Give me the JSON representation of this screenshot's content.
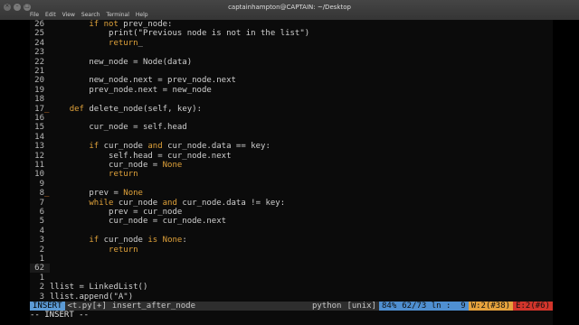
{
  "window": {
    "title": "captainhampton@CAPTAIN: ~/Desktop",
    "menu": [
      "File",
      "Edit",
      "View",
      "Search",
      "Terminal",
      "Help"
    ],
    "buttons": [
      "×",
      "–",
      "□"
    ]
  },
  "editor": {
    "lines": [
      {
        "n": "26",
        "sign": "",
        "segs": [
          {
            "t": "        "
          },
          {
            "t": "if not",
            "c": "kw"
          },
          {
            "t": " prev_node:"
          }
        ]
      },
      {
        "n": "25",
        "sign": "",
        "segs": [
          {
            "t": "            print(\"Previous node is not in the list\")"
          }
        ]
      },
      {
        "n": "24",
        "sign": "",
        "segs": [
          {
            "t": "            "
          },
          {
            "t": "return",
            "c": "kw"
          },
          {
            "t": "_"
          }
        ]
      },
      {
        "n": "23",
        "sign": "",
        "segs": [
          {
            "t": ""
          }
        ]
      },
      {
        "n": "22",
        "sign": "",
        "segs": [
          {
            "t": "        new_node = Node(data)"
          }
        ]
      },
      {
        "n": "21",
        "sign": "",
        "segs": [
          {
            "t": ""
          }
        ]
      },
      {
        "n": "20",
        "sign": "",
        "segs": [
          {
            "t": "        new_node.next = prev_node.next"
          }
        ]
      },
      {
        "n": "19",
        "sign": "",
        "segs": [
          {
            "t": "        prev_node.next = new_node"
          }
        ]
      },
      {
        "n": "18",
        "sign": "",
        "segs": [
          {
            "t": ""
          }
        ]
      },
      {
        "n": "17",
        "sign": "_",
        "segs": [
          {
            "t": "    "
          },
          {
            "t": "def",
            "c": "kw"
          },
          {
            "t": " delete_node(self, key):"
          }
        ]
      },
      {
        "n": "16",
        "sign": "",
        "segs": [
          {
            "t": ""
          }
        ]
      },
      {
        "n": "15",
        "sign": "",
        "segs": [
          {
            "t": "        cur_node = self.head"
          }
        ]
      },
      {
        "n": "14",
        "sign": "",
        "segs": [
          {
            "t": ""
          }
        ]
      },
      {
        "n": "13",
        "sign": "",
        "segs": [
          {
            "t": "        "
          },
          {
            "t": "if",
            "c": "kw"
          },
          {
            "t": " cur_node "
          },
          {
            "t": "and",
            "c": "kw"
          },
          {
            "t": " cur_node.data == key:"
          }
        ]
      },
      {
        "n": "12",
        "sign": "",
        "segs": [
          {
            "t": "            self.head = cur_node.next"
          }
        ]
      },
      {
        "n": "11",
        "sign": "",
        "segs": [
          {
            "t": "            cur_node = "
          },
          {
            "t": "None",
            "c": "kw"
          }
        ]
      },
      {
        "n": "10",
        "sign": "",
        "segs": [
          {
            "t": "            "
          },
          {
            "t": "return",
            "c": "kw"
          }
        ]
      },
      {
        "n": "9",
        "sign": "",
        "segs": [
          {
            "t": ""
          }
        ]
      },
      {
        "n": "8",
        "sign": "_",
        "segs": [
          {
            "t": "        prev = "
          },
          {
            "t": "None",
            "c": "kw"
          }
        ]
      },
      {
        "n": "7",
        "sign": "",
        "segs": [
          {
            "t": "        "
          },
          {
            "t": "while",
            "c": "kw"
          },
          {
            "t": " cur_node "
          },
          {
            "t": "and",
            "c": "kw"
          },
          {
            "t": " cur_node.data != key:"
          }
        ]
      },
      {
        "n": "6",
        "sign": "",
        "segs": [
          {
            "t": "            prev = cur_node"
          }
        ]
      },
      {
        "n": "5",
        "sign": "",
        "segs": [
          {
            "t": "            cur_node = cur_node.next"
          }
        ]
      },
      {
        "n": "4",
        "sign": "",
        "segs": [
          {
            "t": ""
          }
        ]
      },
      {
        "n": "3",
        "sign": "",
        "segs": [
          {
            "t": "        "
          },
          {
            "t": "if",
            "c": "kw"
          },
          {
            "t": " cur_node "
          },
          {
            "t": "is",
            "c": "kw"
          },
          {
            "t": " "
          },
          {
            "t": "None",
            "c": "kw"
          },
          {
            "t": ":"
          }
        ]
      },
      {
        "n": "2",
        "sign": "",
        "segs": [
          {
            "t": "            "
          },
          {
            "t": "return",
            "c": "kw"
          }
        ]
      },
      {
        "n": "1",
        "sign": "",
        "segs": [
          {
            "t": ""
          }
        ]
      },
      {
        "n": "62",
        "sign": "",
        "segs": [
          {
            "t": ""
          }
        ],
        "current": true
      },
      {
        "n": "1",
        "sign": "",
        "segs": [
          {
            "t": ""
          }
        ]
      },
      {
        "n": "2",
        "sign": "",
        "segs": [
          {
            "t": "llist = LinkedList()"
          }
        ]
      },
      {
        "n": "3",
        "sign": "",
        "segs": [
          {
            "t": "llist.append(\"A\")"
          }
        ]
      }
    ]
  },
  "statusbar": {
    "mode": "INSERT",
    "file": "<t.py[+]",
    "function": "insert_after_node",
    "filetype": "python",
    "encoding": "[unix]",
    "percent": "84%",
    "position": "62/73 ln :  9",
    "warnings": "W:2(#38)",
    "errors": "E:2(#6)"
  },
  "cmdline": "-- INSERT --",
  "colors": {
    "keyword": "#e0a23a",
    "mode_bg": "#5c9bd6",
    "warn_bg": "#e6a23c",
    "err_bg": "#d2352b"
  }
}
